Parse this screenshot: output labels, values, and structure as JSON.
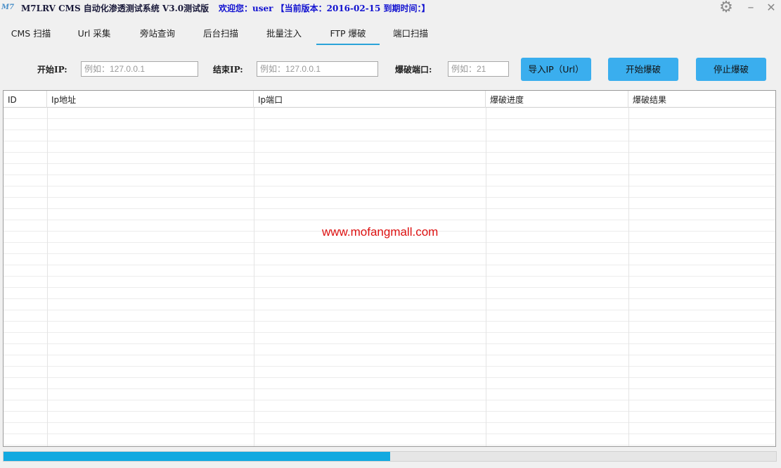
{
  "app": {
    "logo_text": "M7",
    "title": "M7LRV CMS 自动化渗透测试系统 V3.0测试版",
    "welcome": "欢迎您：user 【当前版本：2016-02-15  到期时间：】"
  },
  "window_controls": {
    "settings_icon": "gear-icon",
    "minimize": "–",
    "close": "✕"
  },
  "tabs": [
    {
      "label": "CMS 扫描"
    },
    {
      "label": "Url 采集"
    },
    {
      "label": "旁站查询"
    },
    {
      "label": "后台扫描"
    },
    {
      "label": "批量注入"
    },
    {
      "label": "FTP 爆破",
      "active": true
    },
    {
      "label": "端口扫描"
    }
  ],
  "form": {
    "start_ip_label": "开始IP:",
    "start_ip_placeholder": "例如：127.0.0.1",
    "end_ip_label": "结束IP:",
    "end_ip_placeholder": "例如：127.0.0.1",
    "port_label": "爆破端口:",
    "port_placeholder": "例如：21",
    "import_button": "导入IP（Url）",
    "start_button": "开始爆破",
    "stop_button": "停止爆破"
  },
  "table": {
    "columns": [
      "ID",
      "Ip地址",
      "Ip端口",
      "爆破进度",
      "爆破结果"
    ],
    "rows": []
  },
  "watermark": "www.mofangmall.com",
  "progress": {
    "percent": 50
  },
  "colors": {
    "accent": "#2ba3d9",
    "button": "#3aaeee",
    "progress_fill": "#12a9e0",
    "welcome_text": "#1010d0",
    "watermark": "#dd1111"
  }
}
